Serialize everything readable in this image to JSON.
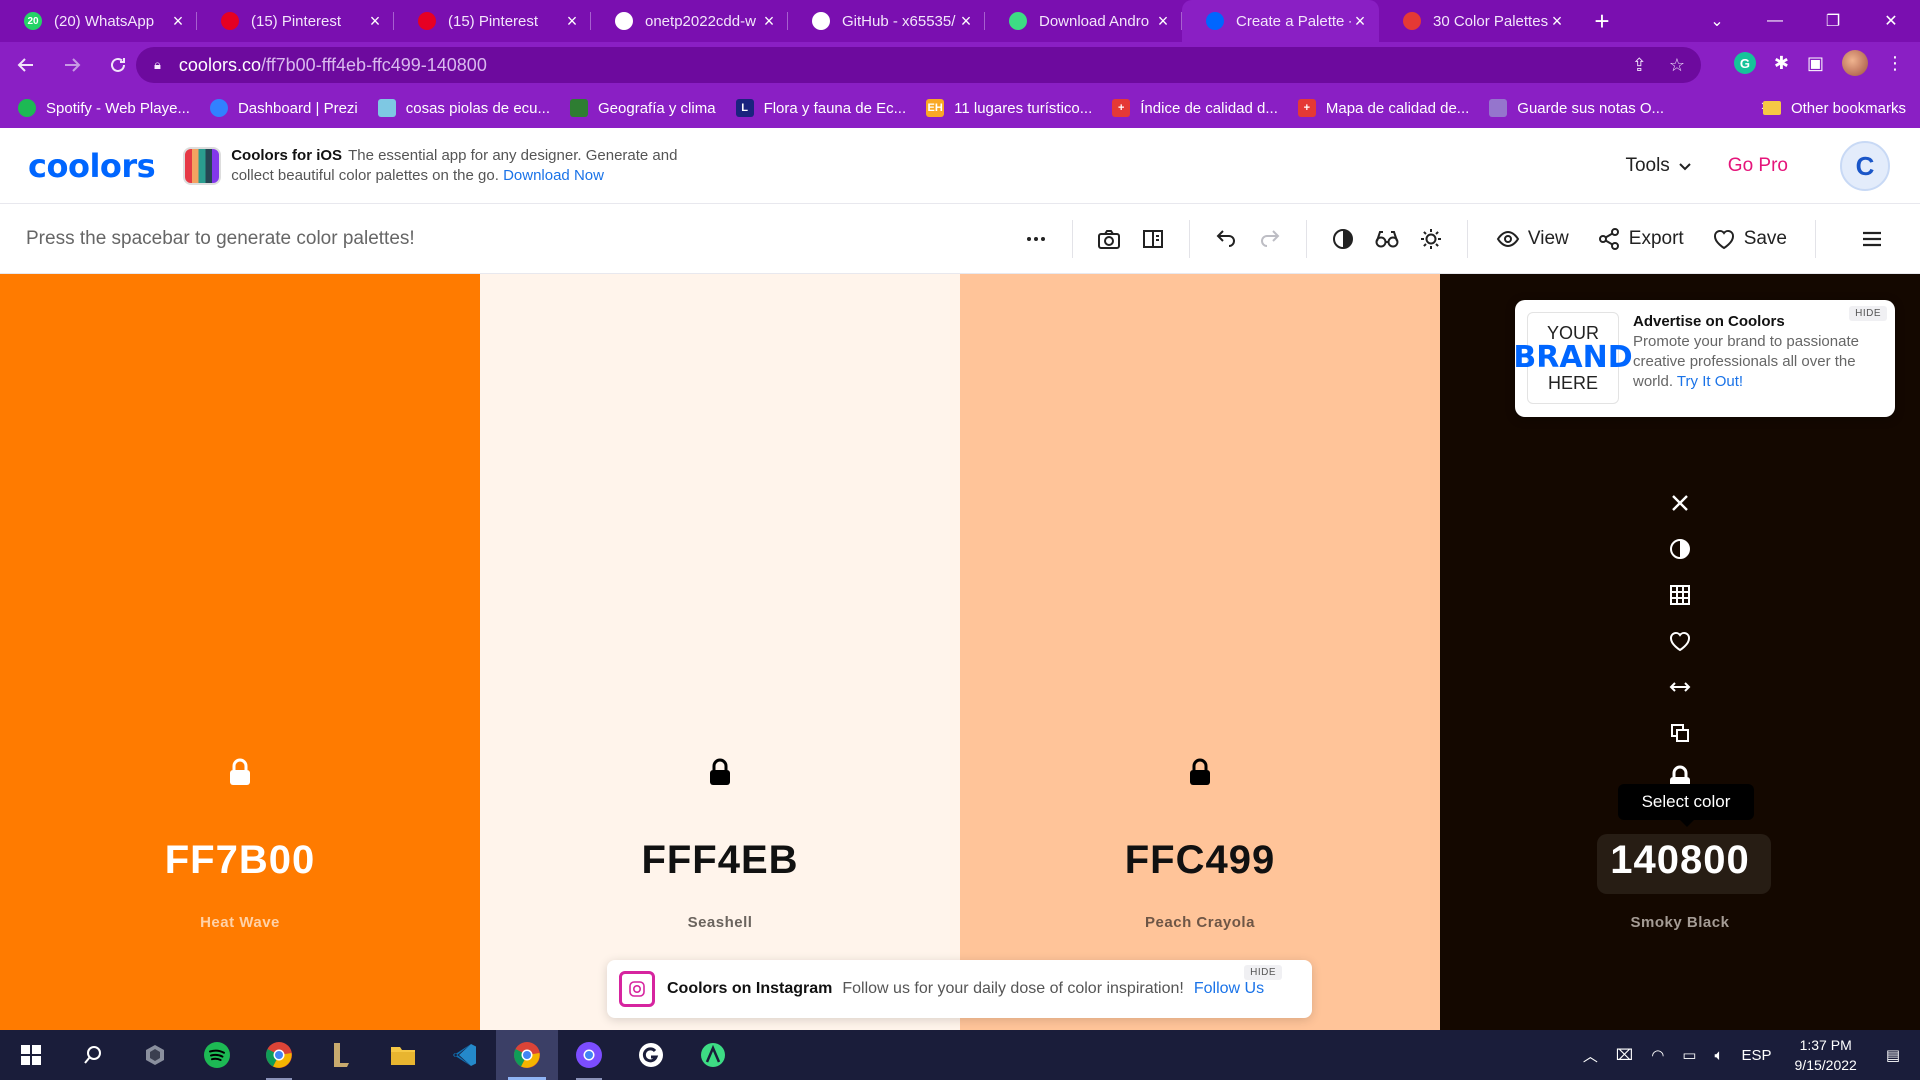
{
  "browser": {
    "tabs": [
      {
        "title": "(20) WhatsApp",
        "icon": "whatsapp-icon",
        "color": "#25d366",
        "badge": "20"
      },
      {
        "title": "(15) Pinterest",
        "icon": "pinterest-icon",
        "color": "#e60023"
      },
      {
        "title": "(15) Pinterest",
        "icon": "pinterest-icon",
        "color": "#e60023"
      },
      {
        "title": "onetp2022cdd-w",
        "icon": "github-icon",
        "color": "#ffffff"
      },
      {
        "title": "GitHub - x65535/",
        "icon": "github-icon",
        "color": "#ffffff"
      },
      {
        "title": "Download Andro",
        "icon": "android-icon",
        "color": "#3ddc84"
      },
      {
        "title": "Create a Palette -",
        "icon": "coolors-icon",
        "color": "#0066ff",
        "active": true
      },
      {
        "title": "30 Color Palettes",
        "icon": "palette-site-icon",
        "color": "#e53935"
      }
    ],
    "url_host": "coolors.co",
    "url_path": "/ff7b00-fff4eb-ffc499-140800",
    "bookmarks": [
      {
        "label": "Spotify - Web Playe...",
        "icon": "spotify-icon",
        "color": "#1db954"
      },
      {
        "label": "Dashboard | Prezi",
        "icon": "prezi-icon",
        "color": "#3181ff"
      },
      {
        "label": "cosas piolas de ecu...",
        "icon": "image-icon",
        "color": "#7ec8e3"
      },
      {
        "label": "Geografía y clima",
        "icon": "map-icon",
        "color": "#2e7d32"
      },
      {
        "label": "Flora y fauna de Ec...",
        "icon": "l-letter-icon",
        "color": "#1a237e",
        "glyph": "L"
      },
      {
        "label": "11 lugares turístico...",
        "icon": "eh-icon",
        "color": "#f9a825",
        "glyph": "EH"
      },
      {
        "label": "Índice de calidad d...",
        "icon": "swiss-cross-icon",
        "color": "#e53935",
        "glyph": "+"
      },
      {
        "label": "Mapa de calidad de...",
        "icon": "swiss-cross-icon",
        "color": "#e53935",
        "glyph": "+"
      },
      {
        "label": "Guarde sus notas O...",
        "icon": "notes-icon",
        "color": "#9575cd"
      }
    ],
    "bookmarks_more": "»",
    "other_bookmarks": "Other bookmarks"
  },
  "header": {
    "logo": "coolors",
    "ios_title": "Coolors for iOS",
    "ios_desc": "The essential app for any designer. Generate and collect beautiful color palettes on the go.",
    "ios_link": "Download Now",
    "tools": "Tools",
    "gopro": "Go Pro",
    "avatar_letter": "C"
  },
  "toolbar": {
    "hint": "Press the spacebar to generate color palettes!",
    "view": "View",
    "export": "Export",
    "save": "Save"
  },
  "palette": {
    "colors": [
      {
        "hex": "FF7B00",
        "name": "Heat Wave",
        "bg": "#ff7b00",
        "fg": "#ffffff",
        "name_fg": "#ffd2a8",
        "lock_color": "#ffffff"
      },
      {
        "hex": "FFF4EB",
        "name": "Seashell",
        "bg": "#fff4eb",
        "fg": "#111111",
        "name_fg": "#6b645e",
        "lock_color": "#000000"
      },
      {
        "hex": "FFC499",
        "name": "Peach Crayola",
        "bg": "#ffc499",
        "fg": "#111111",
        "name_fg": "#6e5646",
        "lock_color": "#000000"
      },
      {
        "hex": "140800",
        "name": "Smoky Black",
        "bg": "#140800",
        "fg": "#ffffff",
        "name_fg": "#a59c95",
        "lock_color": "#ffffff"
      }
    ],
    "tooltip": "Select color"
  },
  "ad": {
    "brand_line1": "YOUR",
    "brand_line2": "BRAND",
    "brand_line3": "HERE",
    "title": "Advertise on Coolors",
    "text": "Promote your brand to passionate creative professionals all over the world.",
    "link": "Try It Out!",
    "hide": "HIDE"
  },
  "instagram": {
    "title": "Coolors on Instagram",
    "text": "Follow us for your daily dose of color inspiration!",
    "link": "Follow Us",
    "hide": "HIDE"
  },
  "taskbar": {
    "language": "ESP",
    "time": "1:37 PM",
    "date": "9/15/2022"
  }
}
